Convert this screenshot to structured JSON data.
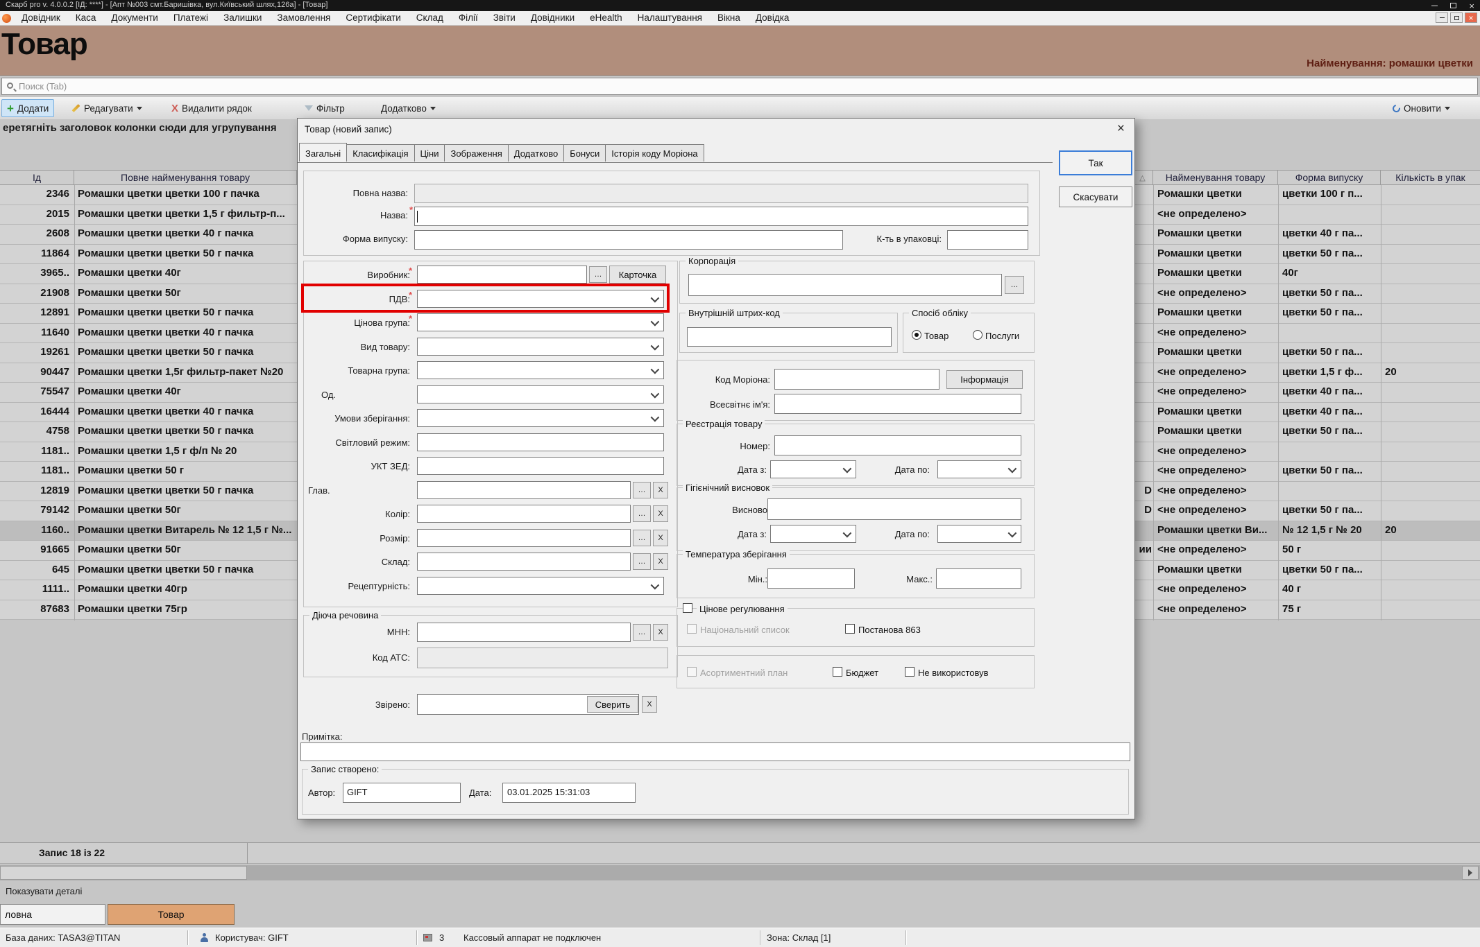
{
  "window": {
    "title": "Скарб pro v. 4.0.0.2 [ІД: ****] - [Апт №003 смт.Баришівка, вул.Київський шлях,126а] - [Товар]"
  },
  "menu": {
    "items": [
      "Довідник",
      "Каса",
      "Документи",
      "Платежі",
      "Залишки",
      "Замовлення",
      "Сертифікати",
      "Склад",
      "Філії",
      "Звіти",
      "Довідники",
      "eHealth",
      "Налаштування",
      "Вікна",
      "Довідка"
    ]
  },
  "header": {
    "title": "Товар",
    "right_label": "Найменування: ромашки цветки"
  },
  "search": {
    "placeholder": "Поиск (Tab)"
  },
  "toolbar": {
    "add": "Додати",
    "edit": "Редагувати",
    "delete": "Видалити рядок",
    "filter": "Фільтр",
    "more": "Додатково",
    "refresh": "Оновити"
  },
  "group_by_hint": "еретягніть заголовок колонки сюди для угрупування",
  "table": {
    "left_headers": {
      "id": "Ід",
      "full_name": "Повне найменування товару"
    },
    "right_headers": {
      "sort": "△",
      "name": "Найменування товару",
      "form": "Форма випуску",
      "qty": "Кількість в упак"
    },
    "rows": [
      {
        "id": "2346",
        "full_name": "Ромашки цветки цветки 100 г пачка",
        "marker": "",
        "name": "Ромашки цветки",
        "form": "цветки 100 г п...",
        "qty": ""
      },
      {
        "id": "2015",
        "full_name": "Ромашки цветки цветки 1,5 г фильтр-п...",
        "marker": "",
        "name": "<не определено>",
        "form": "",
        "qty": ""
      },
      {
        "id": "2608",
        "full_name": "Ромашки цветки цветки 40 г пачка",
        "marker": "",
        "name": "Ромашки цветки",
        "form": "цветки 40 г па...",
        "qty": ""
      },
      {
        "id": "11864",
        "full_name": "Ромашки цветки цветки 50 г пачка",
        "marker": "",
        "name": "Ромашки цветки",
        "form": "цветки 50 г па...",
        "qty": ""
      },
      {
        "id": "3965..",
        "full_name": "Ромашки цветки 40г",
        "marker": "",
        "name": "Ромашки цветки",
        "form": "40г",
        "qty": ""
      },
      {
        "id": "21908",
        "full_name": "Ромашки цветки 50г",
        "marker": "",
        "name": "<не определено>",
        "form": "цветки 50 г па...",
        "qty": ""
      },
      {
        "id": "12891",
        "full_name": "Ромашки цветки цветки 50 г пачка",
        "marker": "",
        "name": "Ромашки цветки",
        "form": "цветки 50 г па...",
        "qty": ""
      },
      {
        "id": "11640",
        "full_name": "Ромашки цветки цветки 40 г пачка",
        "marker": "",
        "name": "<не определено>",
        "form": "",
        "qty": ""
      },
      {
        "id": "19261",
        "full_name": "Ромашки цветки цветки 50 г пачка",
        "marker": "",
        "name": "Ромашки цветки",
        "form": "цветки 50 г па...",
        "qty": ""
      },
      {
        "id": "90447",
        "full_name": "Ромашки цветки 1,5г фильтр-пакет №20",
        "marker": "",
        "name": "<не определено>",
        "form": "цветки 1,5 г ф...",
        "qty": "20"
      },
      {
        "id": "75547",
        "full_name": "Ромашки цветки 40г",
        "marker": "",
        "name": "<не определено>",
        "form": "цветки 40 г па...",
        "qty": ""
      },
      {
        "id": "16444",
        "full_name": "Ромашки цветки цветки 40 г пачка",
        "marker": "",
        "name": "Ромашки цветки",
        "form": "цветки 40 г па...",
        "qty": ""
      },
      {
        "id": "4758",
        "full_name": "Ромашки цветки цветки 50 г пачка",
        "marker": "",
        "name": "Ромашки цветки",
        "form": "цветки 50 г па...",
        "qty": ""
      },
      {
        "id": "1181..",
        "full_name": "Ромашки цветки 1,5 г ф/п № 20",
        "marker": "",
        "name": "<не определено>",
        "form": "",
        "qty": ""
      },
      {
        "id": "1181..",
        "full_name": "Ромашки цветки 50 г",
        "marker": "",
        "name": "<не определено>",
        "form": "цветки 50 г па...",
        "qty": ""
      },
      {
        "id": "12819",
        "full_name": "Ромашки цветки цветки 50 г пачка",
        "marker": "D",
        "name": "<не определено>",
        "form": "",
        "qty": ""
      },
      {
        "id": "79142",
        "full_name": "Ромашки цветки 50г",
        "marker": "D",
        "name": "<не определено>",
        "form": "цветки 50 г па...",
        "qty": ""
      },
      {
        "id": "1160..",
        "full_name": "Ромашки цветки Витарель № 12 1,5 г №...",
        "marker": "",
        "name": "Ромашки цветки Ви...",
        "form": "№ 12 1,5 г № 20",
        "qty": "20",
        "selected": true
      },
      {
        "id": "91665",
        "full_name": "Ромашки цветки 50г",
        "marker": "ии",
        "name": "<не определено>",
        "form": "50 г",
        "qty": ""
      },
      {
        "id": "645",
        "full_name": "Ромашки цветки цветки 50 г пачка",
        "marker": "",
        "name": "Ромашки цветки",
        "form": "цветки 50 г па...",
        "qty": ""
      },
      {
        "id": "1111..",
        "full_name": "Ромашки цветки 40гр",
        "marker": "",
        "name": "<не определено>",
        "form": "40 г",
        "qty": ""
      },
      {
        "id": "87683",
        "full_name": "Ромашки цветки 75гр",
        "marker": "",
        "name": "<не определено>",
        "form": "75 г",
        "qty": ""
      }
    ]
  },
  "footer": {
    "record_counter": "Запис 18 із 22"
  },
  "details_toggle": "Показувати деталі",
  "bottom_tabs": [
    {
      "label": "ловна",
      "active": false
    },
    {
      "label": "Товар",
      "active": true
    }
  ],
  "statusbar": {
    "database": "База даних: TASA3@TITAN",
    "user": "Користувач: GIFT",
    "cash_count": "3",
    "cash_status": "Кассовый аппарат не подключен",
    "zone": "Зона: Склад [1]"
  },
  "dialog": {
    "title": "Товар (новий запис)",
    "close": "×",
    "tabs": [
      "Загальні",
      "Класифікація",
      "Ціни",
      "Зображення",
      "Додатково",
      "Бонуси",
      "Історія коду Моріона"
    ],
    "active_tab": "Загальні",
    "ok": "Так",
    "cancel": "Скасувати",
    "top": {
      "full_name_label": "Повна назва:",
      "name_label": "Назва:",
      "form_label": "Форма випуску:",
      "qty_label": "К-ть в упаковці:"
    },
    "left_fields": [
      {
        "label": "Виробник:",
        "required": true,
        "type": "producer"
      },
      {
        "label": "ПДВ:",
        "required": true,
        "type": "combo"
      },
      {
        "label": "Цінова група:",
        "required": true,
        "type": "combo"
      },
      {
        "label": "Вид товару:",
        "required": false,
        "type": "combo"
      },
      {
        "label": "Товарна група:",
        "required": false,
        "type": "combo"
      },
      {
        "label": "Од.",
        "required": false,
        "type": "combo"
      },
      {
        "label": "Умови зберігання:",
        "required": false,
        "type": "combo"
      },
      {
        "label": "Світловий режим:",
        "required": false,
        "type": "input"
      },
      {
        "label": "УКТ ЗЕД:",
        "required": false,
        "type": "input"
      },
      {
        "label": "Глав.",
        "required": false,
        "type": "lookup"
      },
      {
        "label": "Колір:",
        "required": false,
        "type": "lookup"
      },
      {
        "label": "Розмір:",
        "required": false,
        "type": "lookup"
      },
      {
        "label": "Склад:",
        "required": false,
        "type": "lookup"
      },
      {
        "label": "Рецептурність:",
        "required": false,
        "type": "combo"
      }
    ],
    "lookup_more": "…",
    "lookup_clear": "X",
    "card_button": "Карточка",
    "substance": {
      "title": "Діюча речовина",
      "mnn_label": "МНН:",
      "atc_label": "Код АТС:"
    },
    "checked_row": {
      "label": "Звірено:",
      "button": "Сверить",
      "clear": "X"
    },
    "note_label": "Примітка:",
    "created": {
      "title": "Запис створено:",
      "author_label": "Автор:",
      "author_value": "GIFT",
      "date_label": "Дата:",
      "date_value": "03.01.2025 15:31:03"
    },
    "right": {
      "corporation_title": "Корпорація",
      "barcode_title": "Внутрішній штрих-код",
      "accounting": {
        "title": "Спосіб обліку",
        "option_goods": "Товар",
        "option_services": "Послуги",
        "selected": "Товар"
      },
      "morion": {
        "code_label": "Код Моріона:",
        "info_button": "Інформація",
        "world_name_label": "Всесвітнє ім'я:"
      },
      "registration": {
        "title": "Реєстрація товару",
        "number_label": "Номер:",
        "date_from_label": "Дата з:",
        "date_to_label": "Дата по:"
      },
      "hygiene": {
        "title": "Гігієнічний висновок",
        "conclusion_label": "Висново",
        "date_from_label": "Дата з:",
        "date_to_label": "Дата по:"
      },
      "temperature": {
        "title": "Температура зберігання",
        "min_label": "Мін.:",
        "max_label": "Макс.:"
      },
      "price_regulation": {
        "label": "Цінове регулювання",
        "national_list": "Національний список",
        "decree": "Постанова 863"
      },
      "assortment": {
        "plan": "Асортиментний план",
        "budget": "Бюджет",
        "not_used": "Не використовув"
      }
    }
  },
  "colors": {
    "accent_header": "#b18e7c",
    "highlight": "#e10000",
    "active_tab": "#dfa373",
    "selection": "#bdbdbd"
  }
}
